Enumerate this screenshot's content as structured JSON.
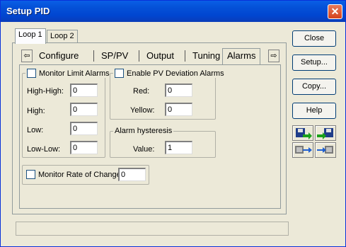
{
  "window": {
    "title": "Setup PID",
    "close_glyph": "✕"
  },
  "loop_tabs": [
    {
      "label": "Loop 1"
    },
    {
      "label": "Loop 2"
    }
  ],
  "subtabs": {
    "left_arrow": "⇦",
    "right_arrow": "⇨",
    "items": [
      {
        "label": "Configure"
      },
      {
        "label": "SP/PV"
      },
      {
        "label": "Output"
      },
      {
        "label": "Tuning"
      },
      {
        "label": "Alarms"
      }
    ]
  },
  "limit_alarms": {
    "title": "Monitor Limit Alarms",
    "checked": false,
    "fields": [
      {
        "label": "High-High:",
        "value": "0"
      },
      {
        "label": "High:",
        "value": "0"
      },
      {
        "label": "Low:",
        "value": "0"
      },
      {
        "label": "Low-Low:",
        "value": "0"
      }
    ]
  },
  "deviation_alarms": {
    "title": "Enable PV Deviation Alarms",
    "checked": false,
    "fields": [
      {
        "label": "Red:",
        "value": "0"
      },
      {
        "label": "Yellow:",
        "value": "0"
      }
    ]
  },
  "hysteresis": {
    "title": "Alarm hysteresis",
    "label": "Value:",
    "value": "1"
  },
  "rate_of_change": {
    "label": "Monitor Rate of Change:",
    "checked": false,
    "value": "0"
  },
  "buttons": {
    "close": "Close",
    "setup": "Setup...",
    "copy": "Copy...",
    "help": "Help"
  },
  "icon_buttons": [
    {
      "icon": "upload-icon"
    },
    {
      "icon": "download-icon"
    },
    {
      "icon": "send-icon"
    },
    {
      "icon": "receive-icon"
    }
  ],
  "status": {
    "text": ""
  }
}
